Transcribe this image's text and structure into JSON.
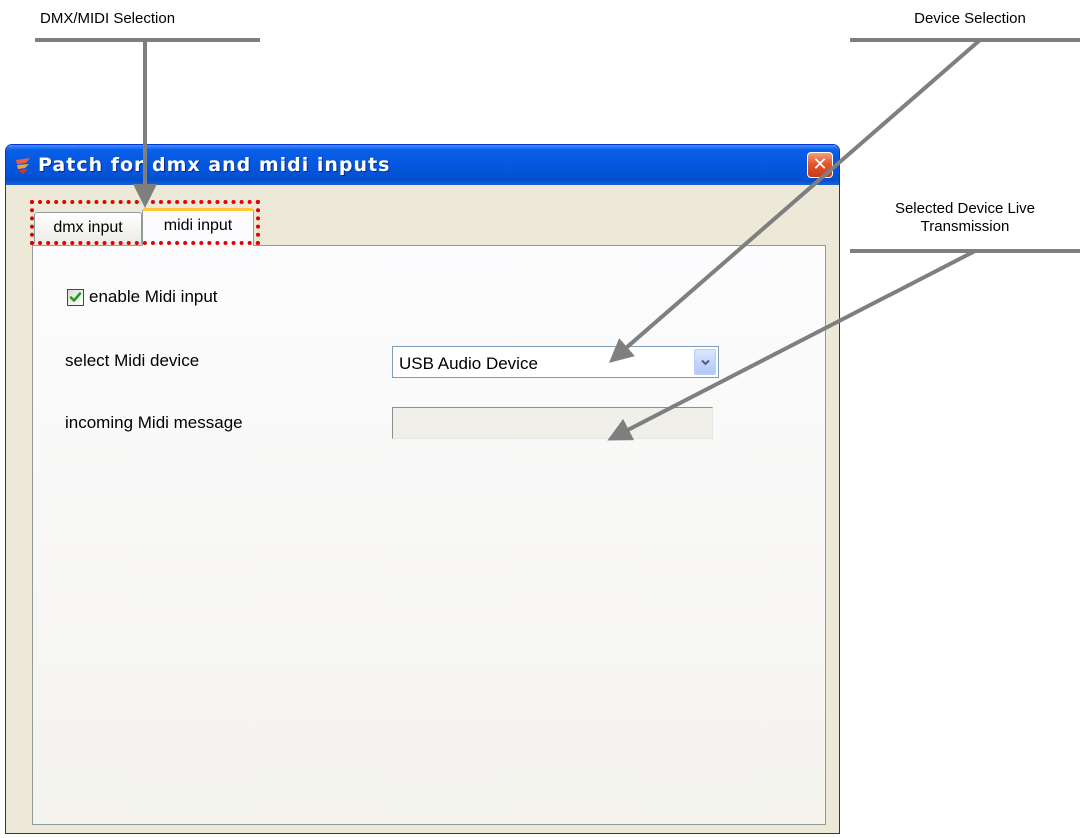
{
  "annotations": {
    "dmx_midi_selection": "DMX/MIDI Selection",
    "device_selection": "Device Selection",
    "live_transmission_line1": "Selected Device Live",
    "live_transmission_line2": "Transmission"
  },
  "window": {
    "title": "Patch for dmx and midi inputs",
    "close_glyph": "✕"
  },
  "tabs": {
    "dmx": "dmx input",
    "midi": "midi input",
    "active": "midi input"
  },
  "panel": {
    "enable_label": "enable Midi input",
    "enable_checked": true,
    "device_label": "select Midi device",
    "device_value": "USB Audio Device",
    "message_label": "incoming Midi message",
    "message_value": ""
  },
  "colors": {
    "titlebar": "#0454d8",
    "window_bg": "#ece9d8",
    "tab_highlight": "#e00000",
    "active_tab_accent": "#ffc83c",
    "checkmark": "#21a121",
    "callout_line": "#7f7f7f"
  },
  "icons": {
    "app": "app-logo-icon",
    "close": "close-icon",
    "check": "checkmark-icon",
    "dropdown": "chevron-down-icon"
  }
}
